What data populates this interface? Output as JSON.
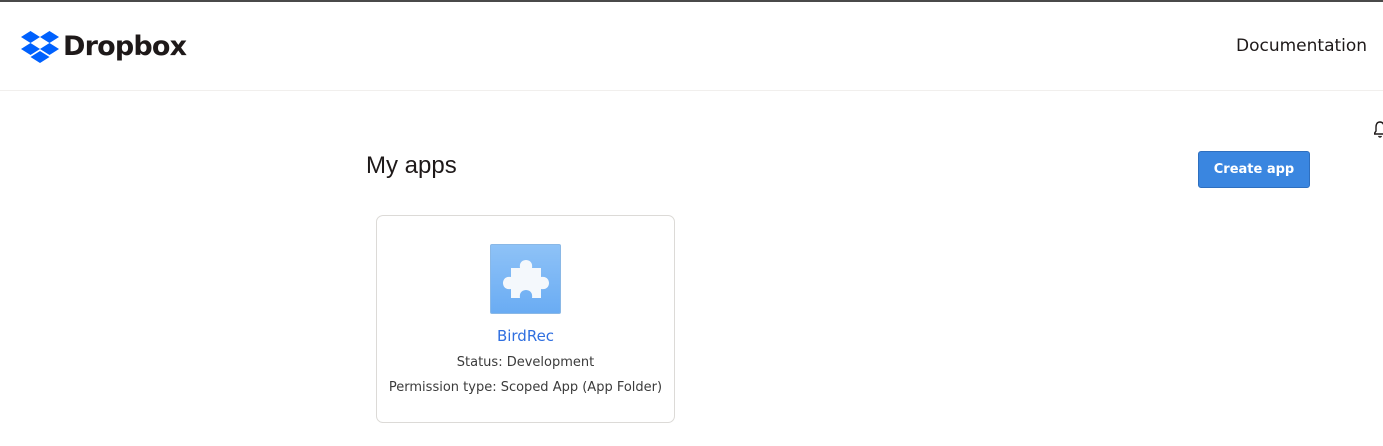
{
  "header": {
    "brand": "Dropbox",
    "nav": {
      "documentation": "Documentation"
    }
  },
  "page": {
    "title": "My apps",
    "create_button": "Create app"
  },
  "apps": [
    {
      "name": "BirdRec",
      "icon": "puzzle-icon",
      "status": "Status: Development",
      "permission": "Permission type: Scoped App (App Folder)"
    }
  ],
  "colors": {
    "brand_blue": "#0061fe",
    "button_blue": "#3a86e0",
    "link_blue": "#2f6fe0",
    "app_icon_blue": "#7ab6f5"
  }
}
